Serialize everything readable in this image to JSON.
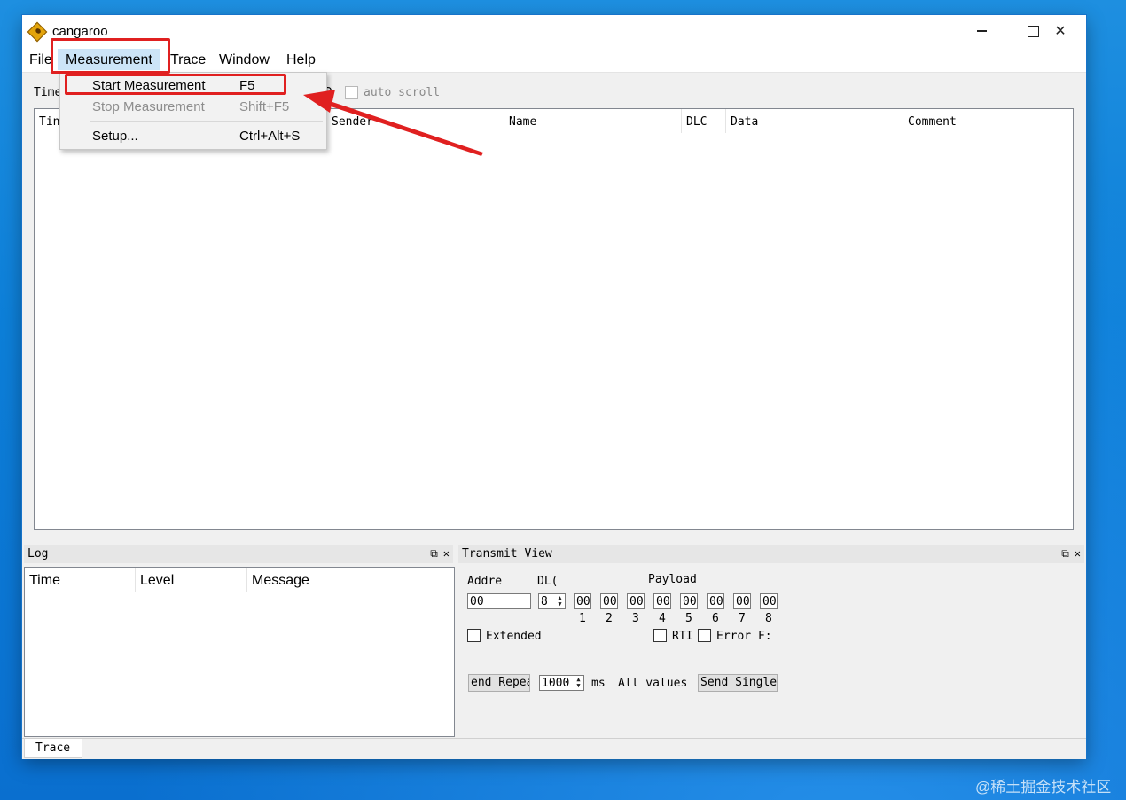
{
  "window": {
    "title": "cangaroo"
  },
  "menubar": {
    "items": [
      "File",
      "Measurement",
      "Trace",
      "Window",
      "Help"
    ]
  },
  "menu_measurement": {
    "start_label": "Start Measurement",
    "start_key": "F5",
    "stop_label": "Stop Measurement",
    "stop_key": "Shift+F5",
    "setup_label": "Setup...",
    "setup_key": "Ctrl+Alt+S"
  },
  "toolbar": {
    "time_label": "Time",
    "d_label": "D",
    "auto_scroll": "auto scroll"
  },
  "trace_columns": [
    "Tin",
    "Sender",
    "Name",
    "DLC",
    "Data",
    "Comment"
  ],
  "log": {
    "title": "Log",
    "columns": [
      "Time",
      "Level",
      "Message"
    ]
  },
  "transmit": {
    "title": "Transmit View",
    "address_label": "Addre",
    "dlc_label": "DL(",
    "payload_label": "Payload",
    "address_value": "00",
    "dlc_value": "8",
    "bytes": [
      "00",
      "00",
      "00",
      "00",
      "00",
      "00",
      "00",
      "00"
    ],
    "byte_numbers": [
      "1",
      "2",
      "3",
      "4",
      "5",
      "6",
      "7",
      "8"
    ],
    "extended_label": "Extended",
    "rtr_label": "RTI",
    "error_label": "Error F:",
    "send_repeat_label": "end Repea",
    "interval_value": "1000",
    "ms_label": "ms",
    "all_values_label": "All values ",
    "send_single_label": "Send Single"
  },
  "bottom_tab": "Trace",
  "dock_icons": {
    "float": "float-icon",
    "close": "close-icon"
  },
  "watermark": "@稀土掘金技术社区",
  "colors": {
    "highlight": "#e02020",
    "menu_active": "#cce4f7",
    "desktop": "#0d7fd8"
  }
}
